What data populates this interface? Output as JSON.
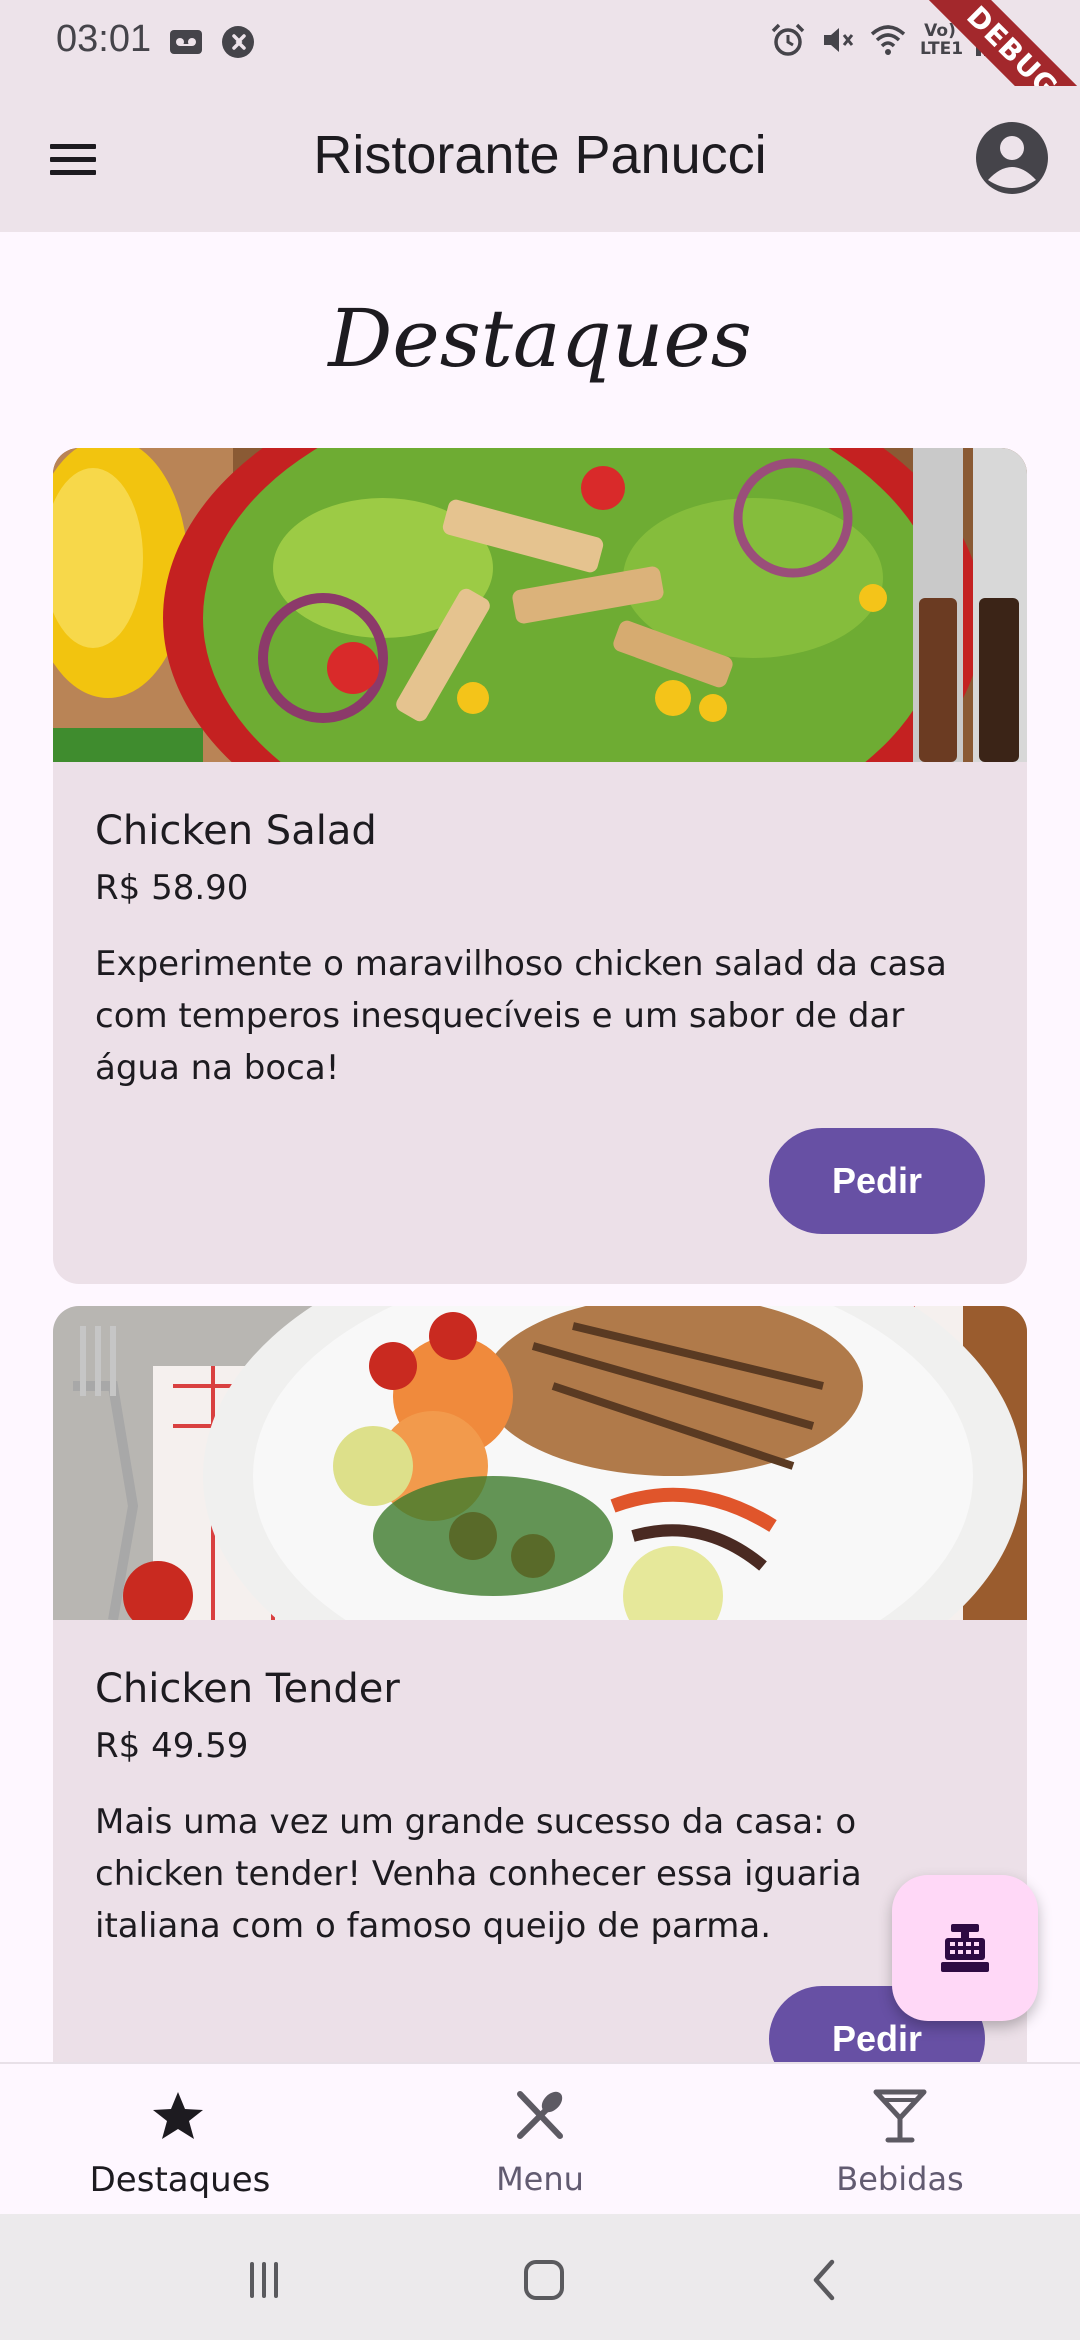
{
  "status_bar": {
    "time": "03:01",
    "network_label": "Vo) LTE1",
    "debug_banner": "DEBUG"
  },
  "app_bar": {
    "title": "Ristorante Panucci",
    "menu_icon": "hamburger-menu-icon",
    "account_icon": "account-circle-icon"
  },
  "page": {
    "section_title": "Destaques"
  },
  "cards": [
    {
      "name": "Chicken Salad",
      "price": "R$ 58.90",
      "description": "Experimente o maravilhoso chicken salad da casa com temperos inesquecíveis e um sabor de dar água na boca!",
      "button_label": "Pedir"
    },
    {
      "name": "Chicken Tender",
      "price": "R$ 49.59",
      "description": "Mais uma vez um grande sucesso da casa: o chicken tender! Venha conhecer essa iguaria italiana com o famoso queijo de parma.",
      "button_label": "Pedir"
    }
  ],
  "fab": {
    "icon": "cash-register-icon"
  },
  "bottom_nav": {
    "items": [
      {
        "label": "Destaques",
        "icon": "star-icon",
        "active": true
      },
      {
        "label": "Menu",
        "icon": "utensils-icon",
        "active": false
      },
      {
        "label": "Bebidas",
        "icon": "cocktail-glass-icon",
        "active": false
      }
    ]
  },
  "colors": {
    "primary": "#6750a4",
    "app_bar": "#ede3ea",
    "card": "#ece0e8",
    "fab": "#ffd8f7",
    "debug_ribbon": "#a3282c"
  }
}
